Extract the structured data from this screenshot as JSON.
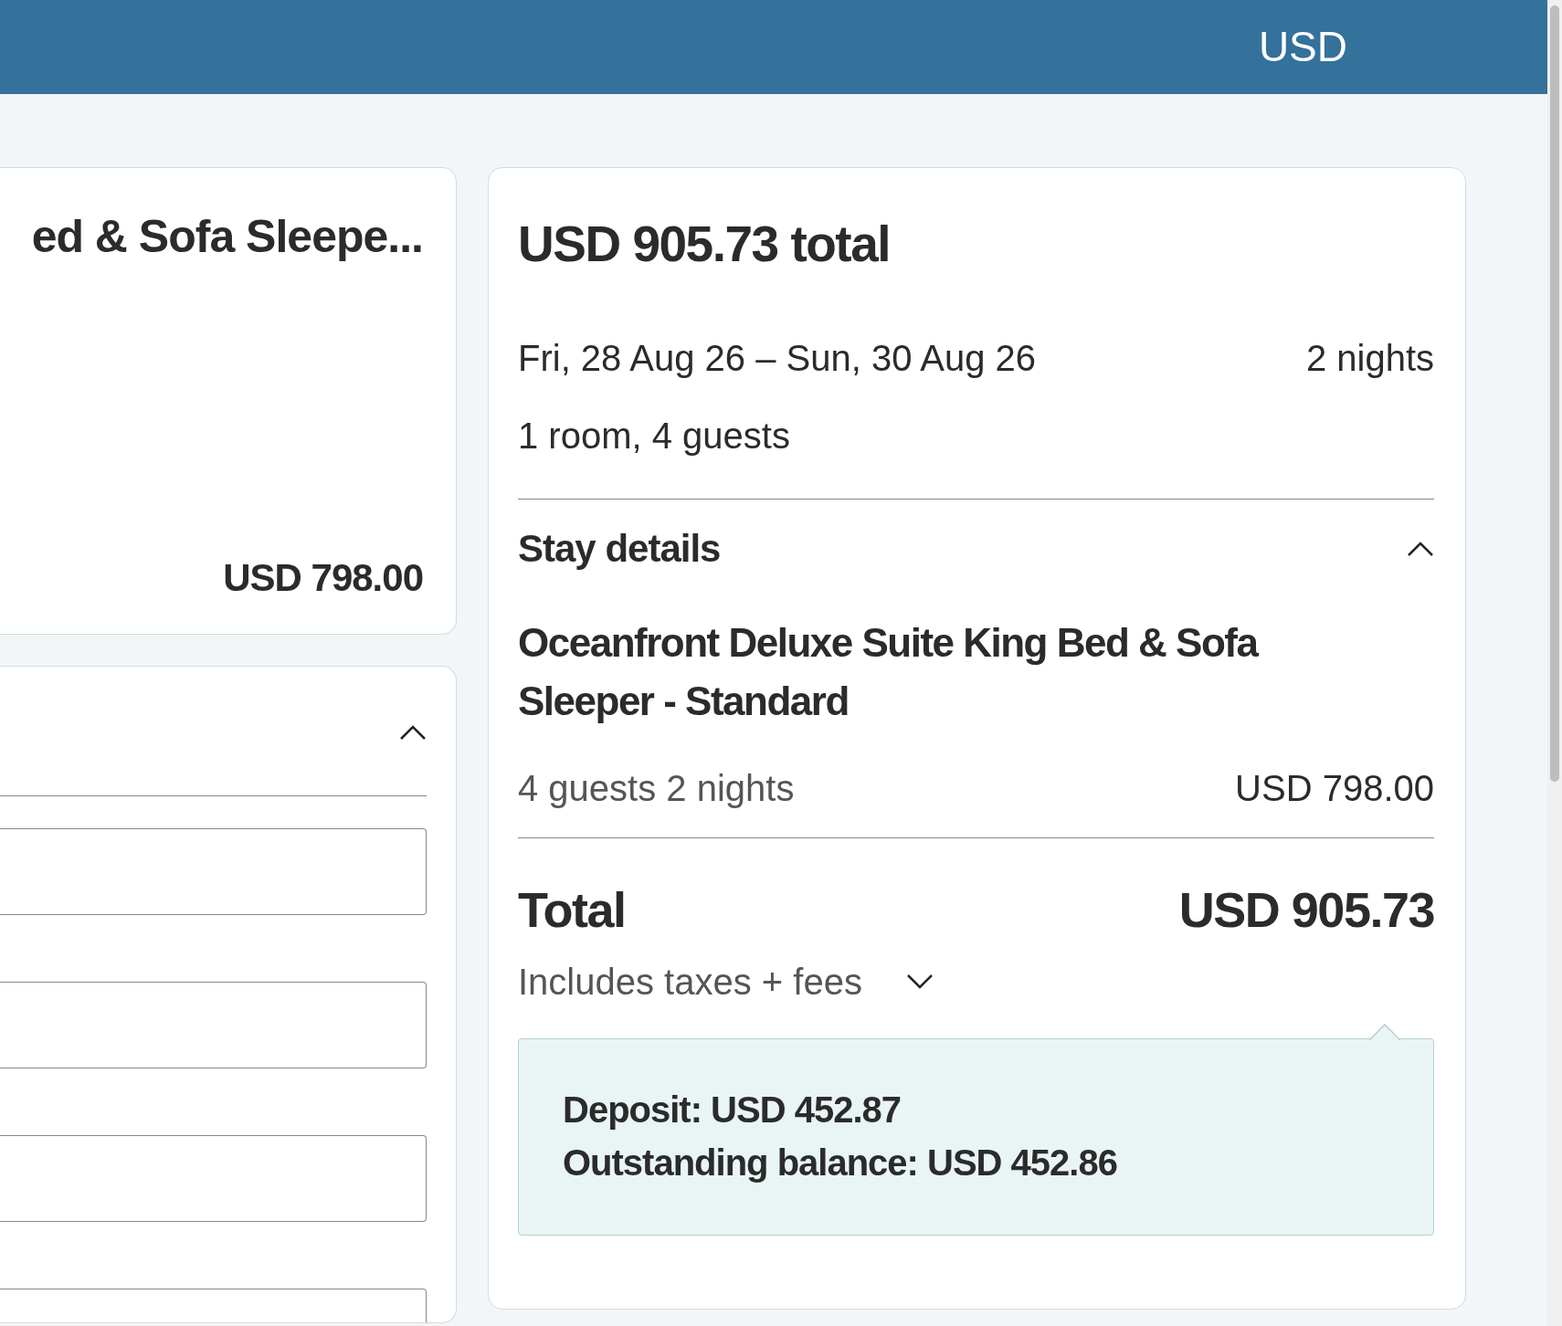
{
  "header": {
    "currency": "USD"
  },
  "room_card": {
    "title": "ed & Sofa Sleepe...",
    "price": "USD 798.00"
  },
  "form_card": {
    "expanded": true,
    "fields": [
      {
        "kind": "text"
      },
      {
        "kind": "text"
      },
      {
        "kind": "text"
      },
      {
        "kind": "text"
      }
    ]
  },
  "summary": {
    "total_heading": "USD 905.73 total",
    "dates": "Fri, 28 Aug 26 – Sun, 30 Aug 26",
    "nights": "2 nights",
    "occupancy": "1 room, 4 guests",
    "stay_details": {
      "title": "Stay details",
      "expanded": true,
      "room_name": "Oceanfront Deluxe Suite King Bed & Sofa Sleeper - Standard",
      "room_meta": "4 guests 2 nights",
      "room_price": "USD 798.00"
    },
    "total_label": "Total",
    "total_value": "USD 905.73",
    "taxes_note": "Includes taxes + fees",
    "taxes_expanded": false,
    "payment_lines": [
      "Deposit: USD 452.87",
      "Outstanding balance: USD 452.86"
    ]
  }
}
